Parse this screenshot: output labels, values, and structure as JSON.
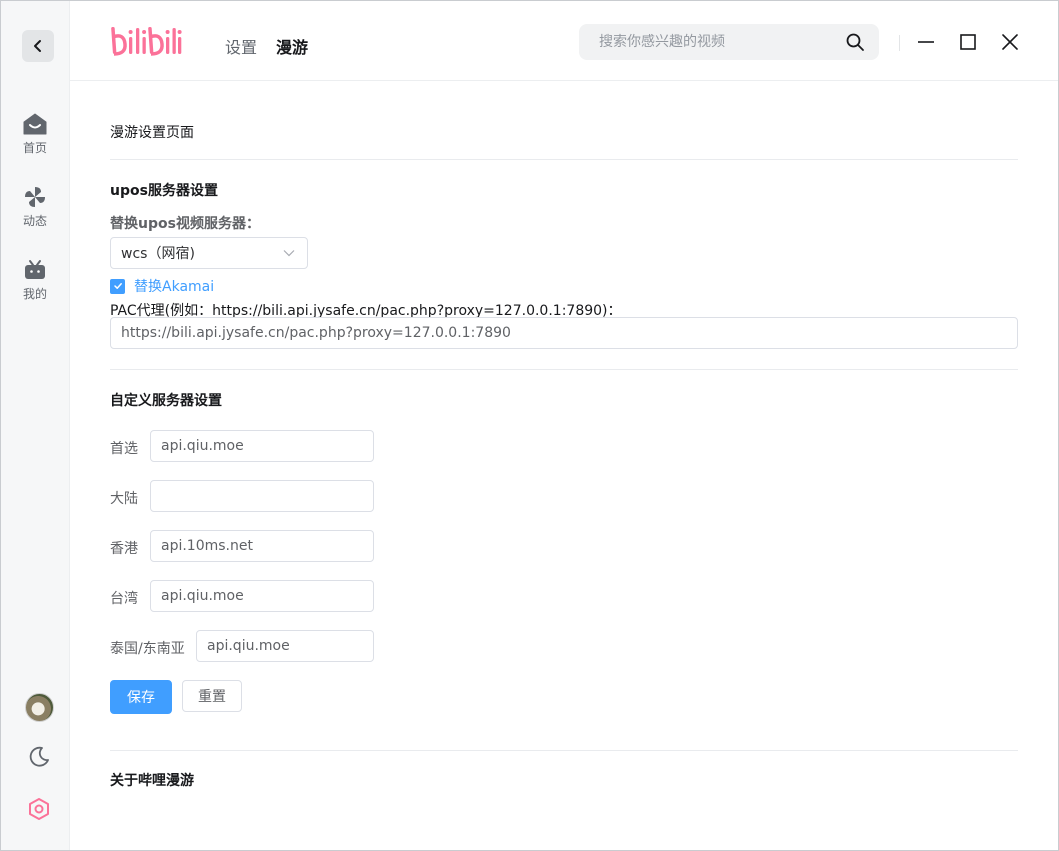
{
  "header": {
    "logo_text": "bilibili",
    "tabs": [
      {
        "label": "设置",
        "active": false
      },
      {
        "label": "漫游",
        "active": true
      }
    ],
    "search": {
      "placeholder": "搜索你感兴趣的视频",
      "value": ""
    },
    "window_controls": [
      "minimize-icon",
      "maximize-icon",
      "close-icon"
    ]
  },
  "sidebar": {
    "back_icon": "chevron-left-icon",
    "items": [
      {
        "label": "首页",
        "icon": "home-icon"
      },
      {
        "label": "动态",
        "icon": "pinwheel-icon"
      },
      {
        "label": "我的",
        "icon": "tv-icon"
      }
    ],
    "bottom_icons": [
      "avatar",
      "moon-icon",
      "settings-hexagon-icon"
    ]
  },
  "page": {
    "title": "漫游设置页面",
    "upos": {
      "section_title": "upos服务器设置",
      "replace_label": "替换upos视频服务器：",
      "selected_server": "wcs（网宿)",
      "akamai_label": "替换Akamai",
      "akamai_checked": true,
      "pac_label": "PAC代理(例如：https://bili.api.jysafe.cn/pac.php?proxy=127.0.0.1:7890)：",
      "pac_value": "https://bili.api.jysafe.cn/pac.php?proxy=127.0.0.1:7890"
    },
    "custom": {
      "section_title": "自定义服务器设置",
      "rows": [
        {
          "label": "首选",
          "value": "api.qiu.moe"
        },
        {
          "label": "大陆",
          "value": ""
        },
        {
          "label": "香港",
          "value": "api.10ms.net"
        },
        {
          "label": "台湾",
          "value": "api.qiu.moe"
        },
        {
          "label": "泰国/东南亚",
          "value": "api.qiu.moe"
        }
      ],
      "save_label": "保存",
      "reset_label": "重置"
    },
    "about_title": "关于哔哩漫游"
  },
  "colors": {
    "brand_pink": "#fb7299",
    "primary_blue": "#409eff"
  }
}
